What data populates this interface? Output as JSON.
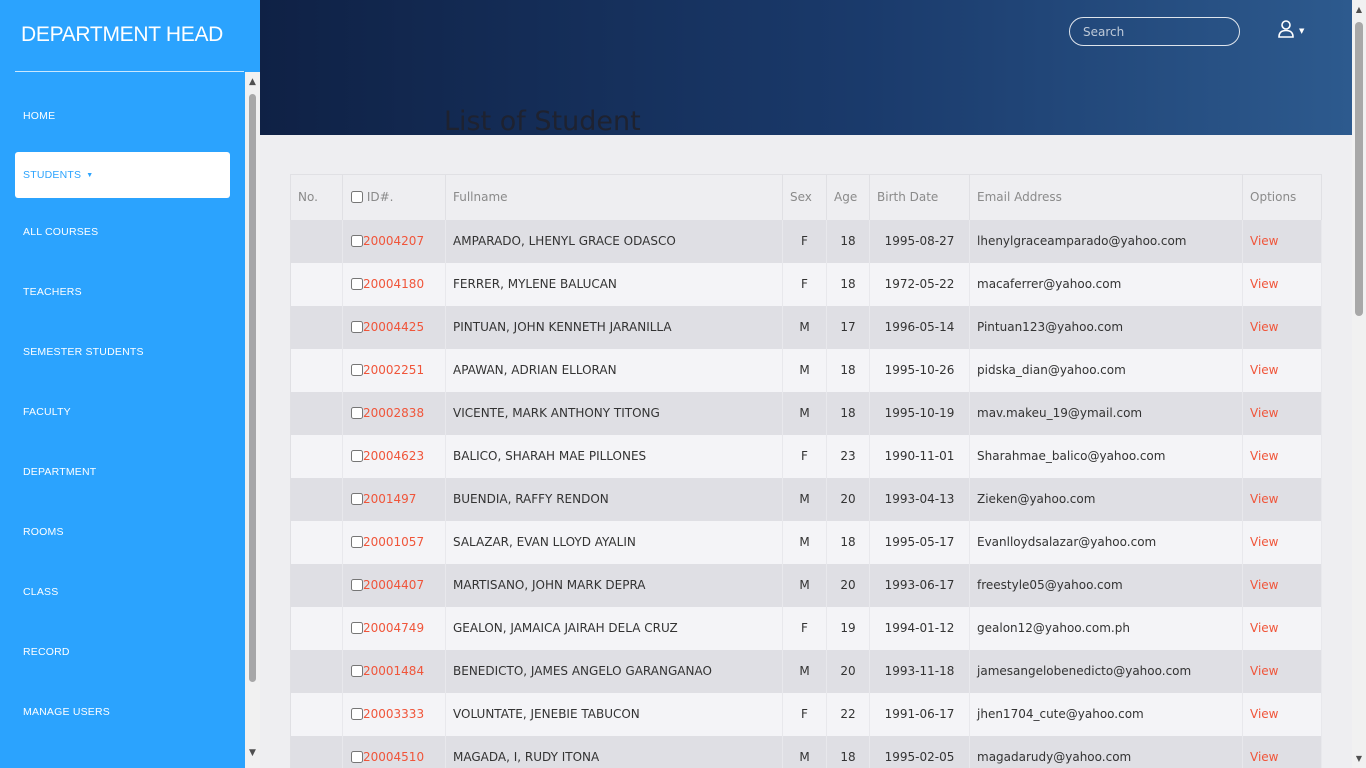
{
  "sidebar": {
    "brand": "DEPARTMENT HEAD",
    "items": [
      {
        "label": "HOME"
      },
      {
        "label": "STUDENTS"
      },
      {
        "label": "ALL COURSES"
      },
      {
        "label": "TEACHERS"
      },
      {
        "label": "SEMESTER STUDENTS"
      },
      {
        "label": "FACULTY"
      },
      {
        "label": "DEPARTMENT"
      },
      {
        "label": "ROOMS"
      },
      {
        "label": "CLASS"
      },
      {
        "label": "RECORD"
      },
      {
        "label": "MANAGE USERS"
      }
    ],
    "active_item": "STUDENTS",
    "caret_icon": "caret-down-icon"
  },
  "header": {
    "search_placeholder": "Search",
    "user_icon": "user-icon",
    "title": "List of Student"
  },
  "colors": {
    "sidebar_bg": "#2ba3fe",
    "header_dark": "#0f2145",
    "header_light": "#2d5a8e",
    "link": "#f0553a"
  },
  "table": {
    "columns": [
      "No.",
      "ID#.",
      "Fullname",
      "Sex",
      "Age",
      "Birth Date",
      "Email Address",
      "Options"
    ],
    "rows": [
      {
        "no": "",
        "id": "20004207",
        "name": "AMPARADO, LHENYL GRACE ODASCO",
        "sex": "F",
        "age": "18",
        "birth": "1995-08-27",
        "email": "lhenylgraceamparado@yahoo.com",
        "option": "View"
      },
      {
        "no": "",
        "id": "20004180",
        "name": "FERRER, MYLENE BALUCAN",
        "sex": "F",
        "age": "18",
        "birth": "1972-05-22",
        "email": "macaferrer@yahoo.com",
        "option": "View"
      },
      {
        "no": "",
        "id": "20004425",
        "name": "PINTUAN, JOHN KENNETH JARANILLA",
        "sex": "M",
        "age": "17",
        "birth": "1996-05-14",
        "email": "Pintuan123@yahoo.com",
        "option": "View"
      },
      {
        "no": "",
        "id": "20002251",
        "name": "APAWAN, ADRIAN ELLORAN",
        "sex": "M",
        "age": "18",
        "birth": "1995-10-26",
        "email": "pidska_dian@yahoo.com",
        "option": "View"
      },
      {
        "no": "",
        "id": "20002838",
        "name": "VICENTE, MARK ANTHONY TITONG",
        "sex": "M",
        "age": "18",
        "birth": "1995-10-19",
        "email": "mav.makeu_19@ymail.com",
        "option": "View"
      },
      {
        "no": "",
        "id": "20004623",
        "name": "BALICO, SHARAH MAE PILLONES",
        "sex": "F",
        "age": "23",
        "birth": "1990-11-01",
        "email": "Sharahmae_balico@yahoo.com",
        "option": "View"
      },
      {
        "no": "",
        "id": "2001497",
        "name": "BUENDIA, RAFFY RENDON",
        "sex": "M",
        "age": "20",
        "birth": "1993-04-13",
        "email": "Zieken@yahoo.com",
        "option": "View"
      },
      {
        "no": "",
        "id": "20001057",
        "name": "SALAZAR, EVAN LLOYD AYALIN",
        "sex": "M",
        "age": "18",
        "birth": "1995-05-17",
        "email": "Evanlloydsalazar@yahoo.com",
        "option": "View"
      },
      {
        "no": "",
        "id": "20004407",
        "name": "MARTISANO, JOHN MARK DEPRA",
        "sex": "M",
        "age": "20",
        "birth": "1993-06-17",
        "email": "freestyle05@yahoo.com",
        "option": "View"
      },
      {
        "no": "",
        "id": "20004749",
        "name": "GEALON, JAMAICA JAIRAH DELA CRUZ",
        "sex": "F",
        "age": "19",
        "birth": "1994-01-12",
        "email": "gealon12@yahoo.com.ph",
        "option": "View"
      },
      {
        "no": "",
        "id": "20001484",
        "name": "BENEDICTO, JAMES ANGELO GARANGANAO",
        "sex": "M",
        "age": "20",
        "birth": "1993-11-18",
        "email": "jamesangelobenedicto@yahoo.com",
        "option": "View"
      },
      {
        "no": "",
        "id": "20003333",
        "name": "VOLUNTATE, JENEBIE TABUCON",
        "sex": "F",
        "age": "22",
        "birth": "1991-06-17",
        "email": "jhen1704_cute@yahoo.com",
        "option": "View"
      },
      {
        "no": "",
        "id": "20004510",
        "name": "MAGADA, I, RUDY ITONA",
        "sex": "M",
        "age": "18",
        "birth": "1995-02-05",
        "email": "magadarudy@yahoo.com",
        "option": "View"
      }
    ]
  }
}
